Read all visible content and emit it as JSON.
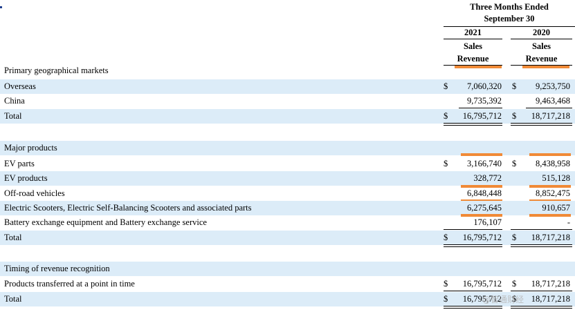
{
  "header": {
    "period_line1": "Three Months Ended",
    "period_line2": "September 30",
    "year_1": "2021",
    "year_2": "2020",
    "col_line1": "Sales",
    "col_line2": "Revenue"
  },
  "currency_symbol": "$",
  "colors": {
    "row_shade": "#dcecf8",
    "highlight": "#f08a37"
  },
  "sections": [
    {
      "title": "Primary geographical markets",
      "rows": [
        {
          "label": "Overseas",
          "v2021": "7,060,320",
          "v2020": "9,253,750"
        },
        {
          "label": "China",
          "v2021": "9,735,392",
          "v2020": "9,463,468"
        },
        {
          "label": "Total",
          "v2021": "16,795,712",
          "v2020": "18,717,218"
        }
      ]
    },
    {
      "title": "Major products",
      "rows": [
        {
          "label": "EV parts",
          "v2021": "3,166,740",
          "v2020": "8,438,958"
        },
        {
          "label": "EV products",
          "v2021": "328,772",
          "v2020": "515,128"
        },
        {
          "label": "Off-road vehicles",
          "v2021": "6,848,448",
          "v2020": "8,852,475"
        },
        {
          "label": "Electric Scooters, Electric Self-Balancing Scooters and associated parts",
          "v2021": "6,275,645",
          "v2020": "910,657"
        },
        {
          "label": "Battery exchange equipment and Battery exchange service",
          "v2021": "176,107",
          "v2020": "-"
        },
        {
          "label": "Total",
          "v2021": "16,795,712",
          "v2020": "18,717,218"
        }
      ]
    },
    {
      "title": "Timing of revenue recognition",
      "rows": [
        {
          "label": "Products transferred at a point in time",
          "v2021": "16,795,712",
          "v2020": "18,717,218"
        },
        {
          "label": "Total",
          "v2021": "16,795,712",
          "v2020": "18,717,218"
        }
      ]
    }
  ],
  "watermark": "@智通财经"
}
